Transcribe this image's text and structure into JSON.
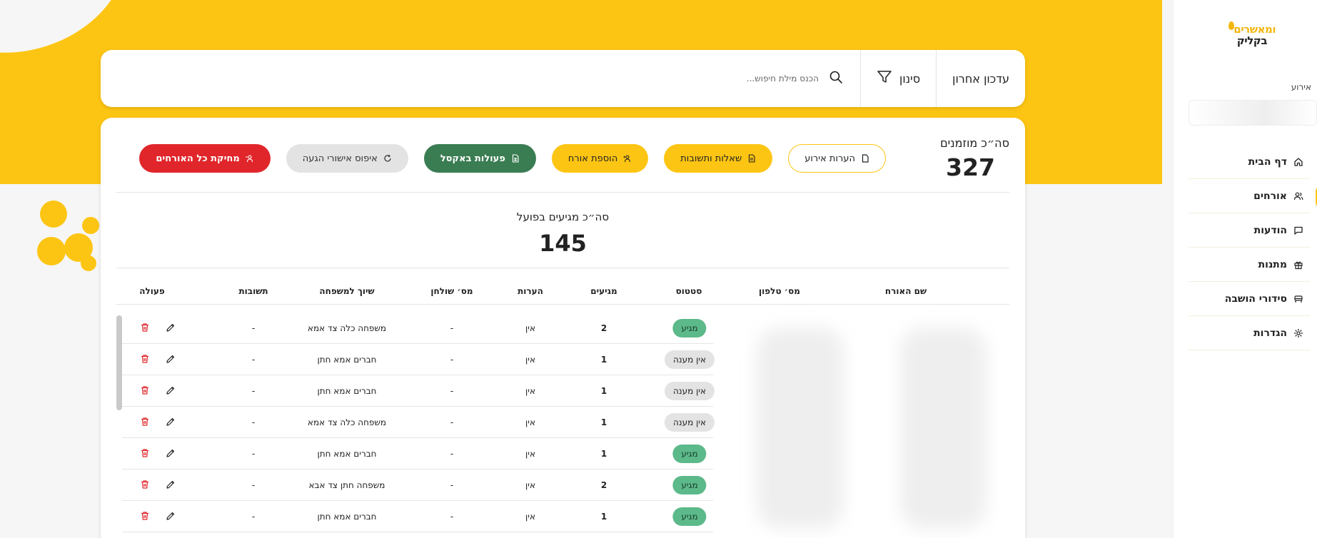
{
  "sidebar": {
    "logo_line1": "ומאשרים",
    "logo_line2": "בקליק",
    "event_label": "אירוע",
    "items": [
      {
        "label": "דף הבית",
        "icon": "home-icon"
      },
      {
        "label": "אורחים",
        "icon": "users-icon",
        "active": true
      },
      {
        "label": "הודעות",
        "icon": "message-icon"
      },
      {
        "label": "מתנות",
        "icon": "gift-icon"
      },
      {
        "label": "סידורי הושבה",
        "icon": "seating-icon"
      },
      {
        "label": "הגדרות",
        "icon": "gear-icon"
      }
    ]
  },
  "searchbar": {
    "last_update": "עדכון אחרון",
    "filter": "סינון",
    "placeholder": "הכנס מילת חיפוש..."
  },
  "summary": {
    "total_invited_label": "סה״כ מוזמנים",
    "total_invited_value": "327",
    "arrived_label": "סה״כ מגיעים בפועל",
    "arrived_value": "145"
  },
  "actions": {
    "event_notes": "הערות אירוע",
    "qa": "שאלות ותשובות",
    "add_guest": "הוספת אורח",
    "excel": "פעולות באקסל",
    "reset": "איפוס אישורי הגעה",
    "delete_all": "מחיקת כל האורחים"
  },
  "table": {
    "headers": {
      "name": "שם האורח",
      "phone": "מס׳ טלפון",
      "status": "סטטוס",
      "arriving": "מגיעים",
      "notes": "הערות",
      "table_no": "מס׳ שולחן",
      "family": "שיוך למשפחה",
      "answers": "תשובות",
      "action": "פעולה"
    },
    "rows": [
      {
        "status": "מגיע",
        "status_type": "arrived",
        "arriving": "2",
        "notes": "אין",
        "table_no": "-",
        "family": "משפחה כלה צד אמא",
        "answers": "-"
      },
      {
        "status": "אין מענה",
        "status_type": "noanswer",
        "arriving": "1",
        "notes": "אין",
        "table_no": "-",
        "family": "חברים אמא חתן",
        "answers": "-"
      },
      {
        "status": "אין מענה",
        "status_type": "noanswer",
        "arriving": "1",
        "notes": "אין",
        "table_no": "-",
        "family": "חברים אמא חתן",
        "answers": "-"
      },
      {
        "status": "אין מענה",
        "status_type": "noanswer",
        "arriving": "1",
        "notes": "אין",
        "table_no": "-",
        "family": "משפחה כלה צד אמא",
        "answers": "-"
      },
      {
        "status": "מגיע",
        "status_type": "arrived",
        "arriving": "1",
        "notes": "אין",
        "table_no": "-",
        "family": "חברים אמא חתן",
        "answers": "-"
      },
      {
        "status": "מגיע",
        "status_type": "arrived",
        "arriving": "2",
        "notes": "אין",
        "table_no": "-",
        "family": "משפחה חתן צד אבא",
        "answers": "-"
      },
      {
        "status": "מגיע",
        "status_type": "arrived",
        "arriving": "1",
        "notes": "אין",
        "table_no": "-",
        "family": "חברים אמא חתן",
        "answers": "-"
      }
    ]
  },
  "colors": {
    "brand_yellow": "#fdc513",
    "excel_green": "#3a7d52",
    "danger_red": "#e0262b",
    "arrived_green": "#5cb98a"
  }
}
